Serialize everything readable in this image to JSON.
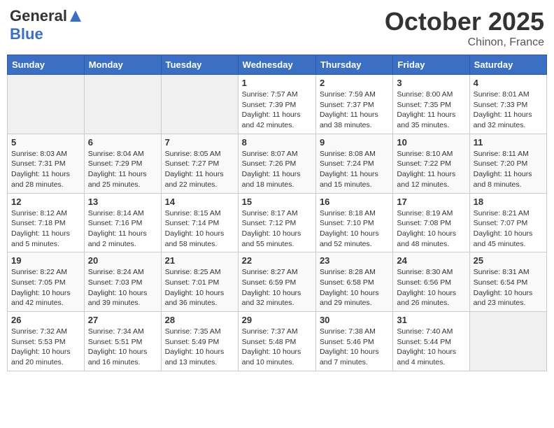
{
  "header": {
    "logo_general": "General",
    "logo_blue": "Blue",
    "month_title": "October 2025",
    "location": "Chinon, France"
  },
  "days_of_week": [
    "Sunday",
    "Monday",
    "Tuesday",
    "Wednesday",
    "Thursday",
    "Friday",
    "Saturday"
  ],
  "weeks": [
    [
      {
        "day": "",
        "sunrise": "",
        "sunset": "",
        "daylight": ""
      },
      {
        "day": "",
        "sunrise": "",
        "sunset": "",
        "daylight": ""
      },
      {
        "day": "",
        "sunrise": "",
        "sunset": "",
        "daylight": ""
      },
      {
        "day": "1",
        "sunrise": "Sunrise: 7:57 AM",
        "sunset": "Sunset: 7:39 PM",
        "daylight": "Daylight: 11 hours and 42 minutes."
      },
      {
        "day": "2",
        "sunrise": "Sunrise: 7:59 AM",
        "sunset": "Sunset: 7:37 PM",
        "daylight": "Daylight: 11 hours and 38 minutes."
      },
      {
        "day": "3",
        "sunrise": "Sunrise: 8:00 AM",
        "sunset": "Sunset: 7:35 PM",
        "daylight": "Daylight: 11 hours and 35 minutes."
      },
      {
        "day": "4",
        "sunrise": "Sunrise: 8:01 AM",
        "sunset": "Sunset: 7:33 PM",
        "daylight": "Daylight: 11 hours and 32 minutes."
      }
    ],
    [
      {
        "day": "5",
        "sunrise": "Sunrise: 8:03 AM",
        "sunset": "Sunset: 7:31 PM",
        "daylight": "Daylight: 11 hours and 28 minutes."
      },
      {
        "day": "6",
        "sunrise": "Sunrise: 8:04 AM",
        "sunset": "Sunset: 7:29 PM",
        "daylight": "Daylight: 11 hours and 25 minutes."
      },
      {
        "day": "7",
        "sunrise": "Sunrise: 8:05 AM",
        "sunset": "Sunset: 7:27 PM",
        "daylight": "Daylight: 11 hours and 22 minutes."
      },
      {
        "day": "8",
        "sunrise": "Sunrise: 8:07 AM",
        "sunset": "Sunset: 7:26 PM",
        "daylight": "Daylight: 11 hours and 18 minutes."
      },
      {
        "day": "9",
        "sunrise": "Sunrise: 8:08 AM",
        "sunset": "Sunset: 7:24 PM",
        "daylight": "Daylight: 11 hours and 15 minutes."
      },
      {
        "day": "10",
        "sunrise": "Sunrise: 8:10 AM",
        "sunset": "Sunset: 7:22 PM",
        "daylight": "Daylight: 11 hours and 12 minutes."
      },
      {
        "day": "11",
        "sunrise": "Sunrise: 8:11 AM",
        "sunset": "Sunset: 7:20 PM",
        "daylight": "Daylight: 11 hours and 8 minutes."
      }
    ],
    [
      {
        "day": "12",
        "sunrise": "Sunrise: 8:12 AM",
        "sunset": "Sunset: 7:18 PM",
        "daylight": "Daylight: 11 hours and 5 minutes."
      },
      {
        "day": "13",
        "sunrise": "Sunrise: 8:14 AM",
        "sunset": "Sunset: 7:16 PM",
        "daylight": "Daylight: 11 hours and 2 minutes."
      },
      {
        "day": "14",
        "sunrise": "Sunrise: 8:15 AM",
        "sunset": "Sunset: 7:14 PM",
        "daylight": "Daylight: 10 hours and 58 minutes."
      },
      {
        "day": "15",
        "sunrise": "Sunrise: 8:17 AM",
        "sunset": "Sunset: 7:12 PM",
        "daylight": "Daylight: 10 hours and 55 minutes."
      },
      {
        "day": "16",
        "sunrise": "Sunrise: 8:18 AM",
        "sunset": "Sunset: 7:10 PM",
        "daylight": "Daylight: 10 hours and 52 minutes."
      },
      {
        "day": "17",
        "sunrise": "Sunrise: 8:19 AM",
        "sunset": "Sunset: 7:08 PM",
        "daylight": "Daylight: 10 hours and 48 minutes."
      },
      {
        "day": "18",
        "sunrise": "Sunrise: 8:21 AM",
        "sunset": "Sunset: 7:07 PM",
        "daylight": "Daylight: 10 hours and 45 minutes."
      }
    ],
    [
      {
        "day": "19",
        "sunrise": "Sunrise: 8:22 AM",
        "sunset": "Sunset: 7:05 PM",
        "daylight": "Daylight: 10 hours and 42 minutes."
      },
      {
        "day": "20",
        "sunrise": "Sunrise: 8:24 AM",
        "sunset": "Sunset: 7:03 PM",
        "daylight": "Daylight: 10 hours and 39 minutes."
      },
      {
        "day": "21",
        "sunrise": "Sunrise: 8:25 AM",
        "sunset": "Sunset: 7:01 PM",
        "daylight": "Daylight: 10 hours and 36 minutes."
      },
      {
        "day": "22",
        "sunrise": "Sunrise: 8:27 AM",
        "sunset": "Sunset: 6:59 PM",
        "daylight": "Daylight: 10 hours and 32 minutes."
      },
      {
        "day": "23",
        "sunrise": "Sunrise: 8:28 AM",
        "sunset": "Sunset: 6:58 PM",
        "daylight": "Daylight: 10 hours and 29 minutes."
      },
      {
        "day": "24",
        "sunrise": "Sunrise: 8:30 AM",
        "sunset": "Sunset: 6:56 PM",
        "daylight": "Daylight: 10 hours and 26 minutes."
      },
      {
        "day": "25",
        "sunrise": "Sunrise: 8:31 AM",
        "sunset": "Sunset: 6:54 PM",
        "daylight": "Daylight: 10 hours and 23 minutes."
      }
    ],
    [
      {
        "day": "26",
        "sunrise": "Sunrise: 7:32 AM",
        "sunset": "Sunset: 5:53 PM",
        "daylight": "Daylight: 10 hours and 20 minutes."
      },
      {
        "day": "27",
        "sunrise": "Sunrise: 7:34 AM",
        "sunset": "Sunset: 5:51 PM",
        "daylight": "Daylight: 10 hours and 16 minutes."
      },
      {
        "day": "28",
        "sunrise": "Sunrise: 7:35 AM",
        "sunset": "Sunset: 5:49 PM",
        "daylight": "Daylight: 10 hours and 13 minutes."
      },
      {
        "day": "29",
        "sunrise": "Sunrise: 7:37 AM",
        "sunset": "Sunset: 5:48 PM",
        "daylight": "Daylight: 10 hours and 10 minutes."
      },
      {
        "day": "30",
        "sunrise": "Sunrise: 7:38 AM",
        "sunset": "Sunset: 5:46 PM",
        "daylight": "Daylight: 10 hours and 7 minutes."
      },
      {
        "day": "31",
        "sunrise": "Sunrise: 7:40 AM",
        "sunset": "Sunset: 5:44 PM",
        "daylight": "Daylight: 10 hours and 4 minutes."
      },
      {
        "day": "",
        "sunrise": "",
        "sunset": "",
        "daylight": ""
      }
    ]
  ]
}
